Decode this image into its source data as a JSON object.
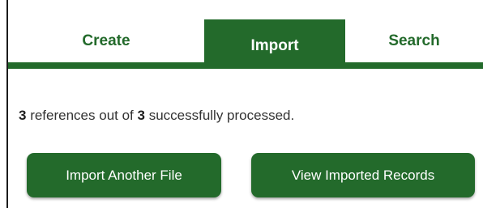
{
  "tabs": [
    {
      "label": "Create",
      "active": false
    },
    {
      "label": "Import",
      "active": true
    },
    {
      "label": "Search",
      "active": false
    }
  ],
  "status": {
    "processed_count": "3",
    "middle_text": " references out of ",
    "total_count": "3",
    "end_text": " successfully processed."
  },
  "actions": {
    "import_another_label": "Import Another File",
    "view_imported_label": "View Imported Records"
  },
  "colors": {
    "accent": "#236a2b",
    "text": "#333333",
    "background": "#ffffff"
  }
}
